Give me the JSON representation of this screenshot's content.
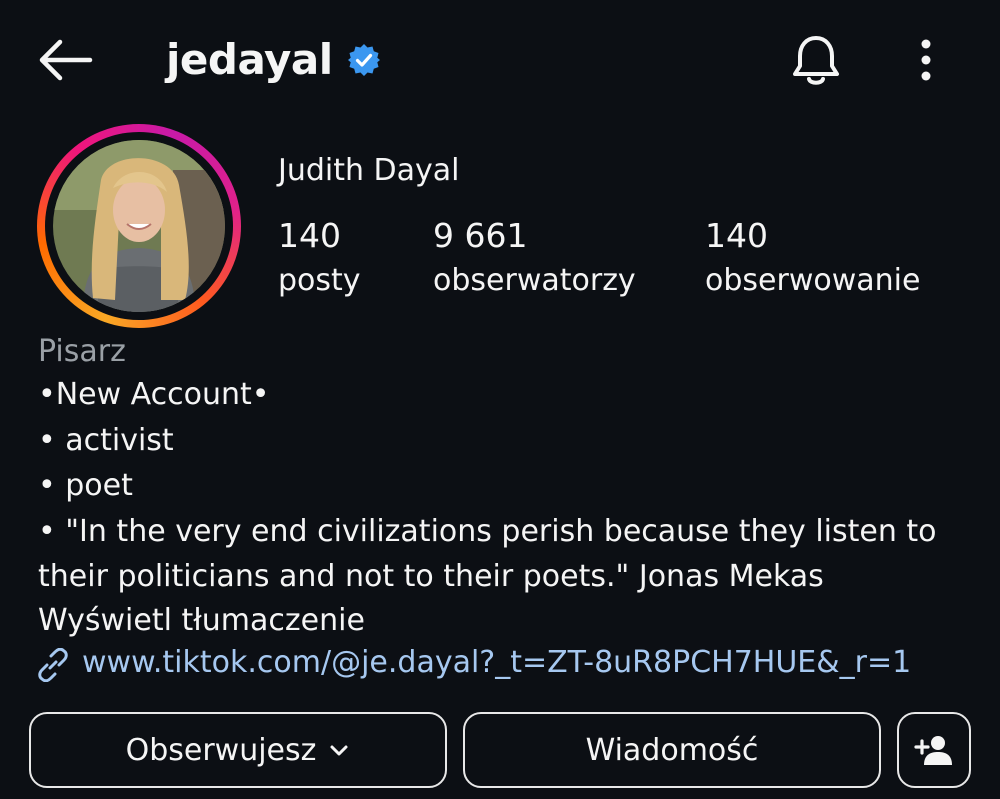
{
  "header": {
    "username": "jedayal",
    "icons": [
      "arrow-left-icon",
      "verified-badge-icon",
      "bell-icon",
      "more-vertical-icon"
    ]
  },
  "profile": {
    "full_name": "Judith Dayal",
    "stats": [
      {
        "value": "140",
        "label": "posty"
      },
      {
        "value": "9 661",
        "label": "obserwatorzy"
      },
      {
        "value": "140",
        "label": "obserwowanie"
      }
    ],
    "category": "Pisarz",
    "bio_lines": [
      "•New Account•",
      "• activist",
      "• poet",
      "• \"In the very end civilizations perish because they listen to",
      "their politicians and not to their poets.\" Jonas Mekas"
    ],
    "translate_label": "Wyświetl tłumaczenie",
    "link": "www.tiktok.com/@je.dayal?_t=ZT-8uR8PCH7HUE&_r=1"
  },
  "actions": {
    "follow_label": "Obserwujesz",
    "message_label": "Wiadomość",
    "add_icon": "add-person-icon"
  },
  "colors": {
    "background": "#0c0f14",
    "verified": "#3b97f0",
    "link": "#a6c8f0",
    "muted": "#9aa0a6"
  }
}
